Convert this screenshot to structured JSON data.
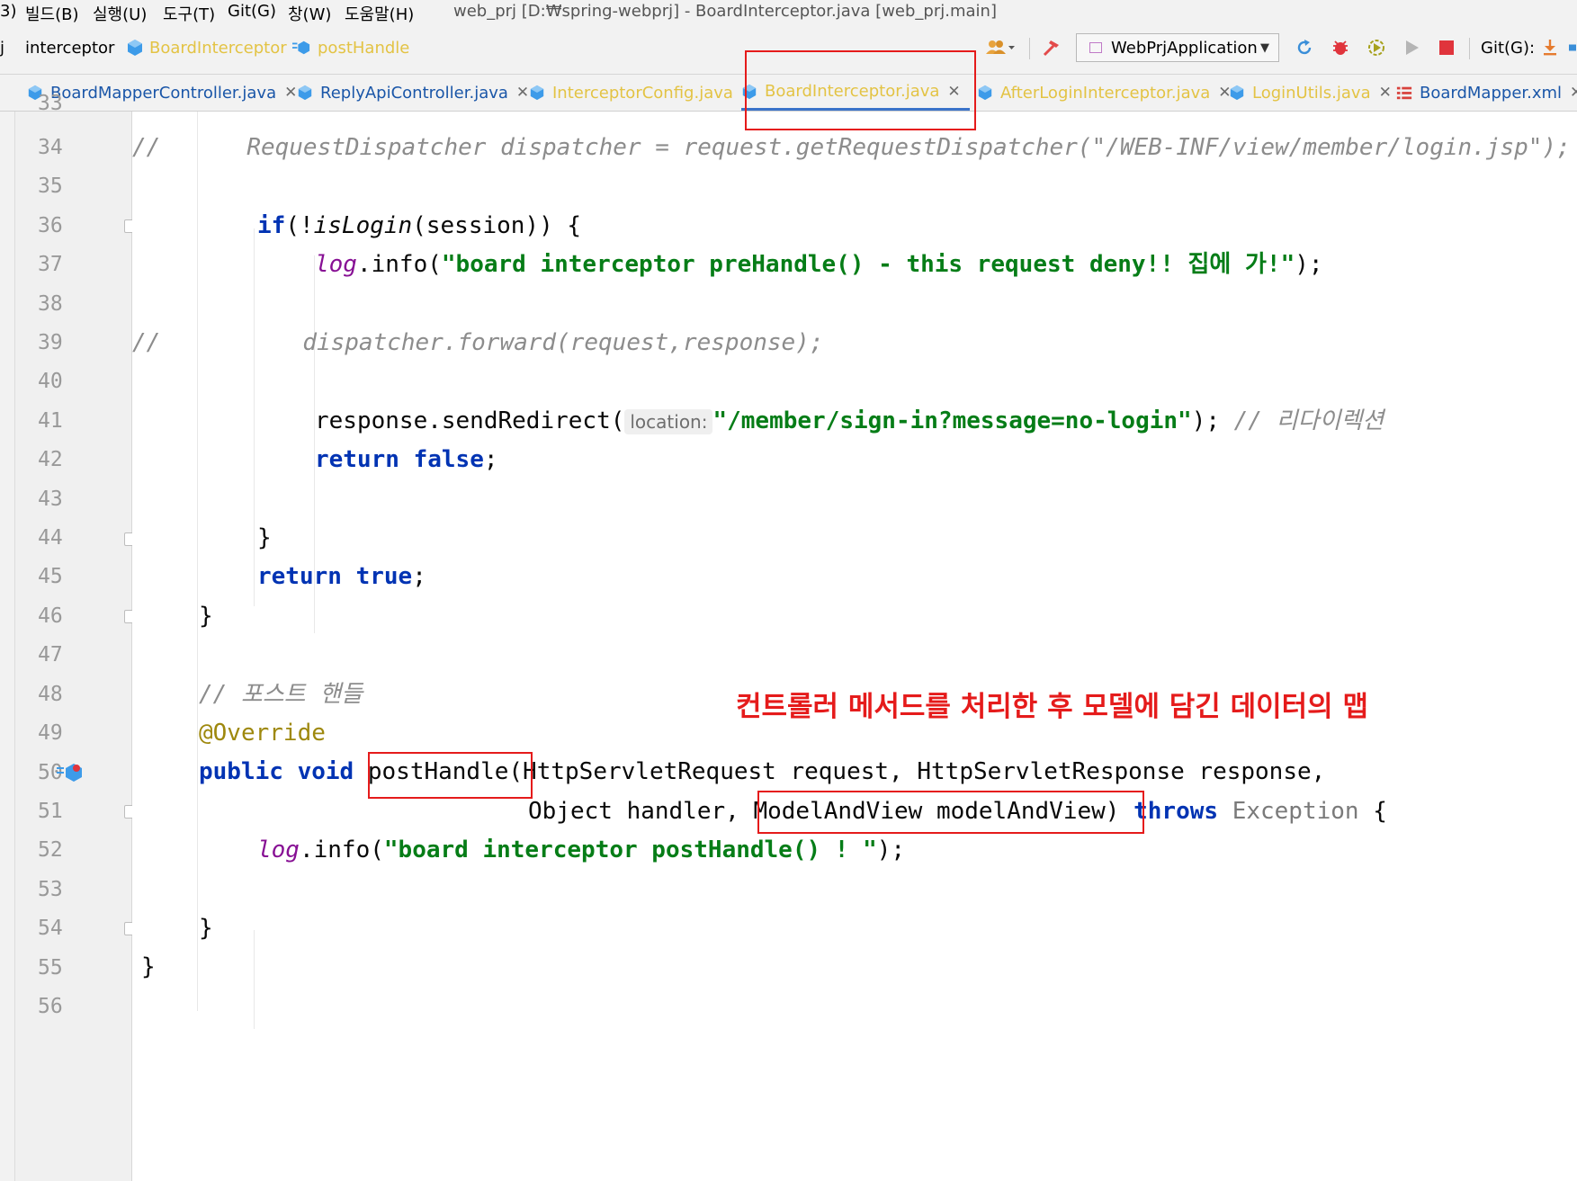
{
  "menubar": {
    "items": [
      "빌드(B)",
      "실행(U)",
      "도구(T)",
      "Git(G)",
      "창(W)",
      "도움말(H)"
    ],
    "partial_left": "3)",
    "window_title": "web_prj [D:₩spring-webprj] - BoardInterceptor.java [web_prj.main]"
  },
  "navbar": {
    "partial_left": "j",
    "crumbs": [
      "interceptor",
      "BoardInterceptor",
      "postHandle"
    ],
    "run_config": "WebPrjApplication",
    "git_label": "Git(G):"
  },
  "tabs": [
    {
      "label": "BoardMapperController.java",
      "style": "normal"
    },
    {
      "label": "ReplyApiController.java",
      "style": "normal"
    },
    {
      "label": "InterceptorConfig.java",
      "style": "muted"
    },
    {
      "label": "BoardInterceptor.java",
      "style": "active"
    },
    {
      "label": "AfterLoginInterceptor.java",
      "style": "muted"
    },
    {
      "label": "LoginUtils.java",
      "style": "muted"
    },
    {
      "label": "BoardMapper.xml",
      "style": "xml"
    }
  ],
  "editor": {
    "line_numbers": [
      "33",
      "34",
      "35",
      "36",
      "37",
      "38",
      "39",
      "40",
      "41",
      "42",
      "43",
      "44",
      "45",
      "46",
      "47",
      "48",
      "49",
      "50",
      "51",
      "52",
      "53",
      "54",
      "55",
      "56"
    ],
    "current_line": "52",
    "code": {
      "l34_comment": "//",
      "l34_text": "RequestDispatcher dispatcher = request.getRequestDispatcher(\"/WEB-INF/view/member/login.jsp\");",
      "l36_if": "if",
      "l36_a": "(!",
      "l36_call": "isLogin",
      "l36_b": "(session)) {",
      "l37_log": "log",
      "l37_info": ".info(",
      "l37_str": "\"board interceptor preHandle() - this request deny!! 집에 가!\"",
      "l37_end": ");",
      "l39_comment": "//",
      "l39_text": "dispatcher.forward(request,response);",
      "l41_call": "response.sendRedirect(",
      "l41_hint": "location:",
      "l41_str": "\"/member/sign-in?message=no-login\"",
      "l41_end": "); ",
      "l41_comment": "// 리다이렉션",
      "l42_return": "return",
      "l42_false": "false",
      "l42_end": ";",
      "l44_brace": "}",
      "l45_return": "return",
      "l45_true": "true",
      "l45_end": ";",
      "l46_brace": "}",
      "l48_comment": "// 포스트 핸들",
      "l49_annotation": "@Override",
      "l50_public": "public",
      "l50_void": "void",
      "l50_method": "postHandle",
      "l50_params": "(HttpServletRequest request, HttpServletResponse response,",
      "l51_params_a": "Object handler, ",
      "l51_params_b": "ModelAndView modelAndView)",
      "l51_throws": "throws",
      "l51_exception": "Exception",
      "l51_end": " {",
      "l52_log": "log",
      "l52_info": ".info(",
      "l52_str": "\"board interceptor postHandle() ! \"",
      "l52_end": ");",
      "l54_brace": "}",
      "l55_brace": "}"
    },
    "annotation_note": "컨트롤러 메서드를 처리한 후 모델에 담긴 데이터의 맵"
  },
  "colors": {
    "keyword": "#0033b3",
    "string": "#067d17",
    "comment": "#8c8c8c",
    "field": "#871094",
    "annotation": "#9e880d",
    "highlight_box": "#e51b1b",
    "current_line_bg": "#fcfae4"
  },
  "icons": {
    "class_icon": "java-class-icon",
    "method_icon": "method-icon",
    "xml_icon": "xml-file-icon",
    "override_marker": "override-marker-icon"
  }
}
